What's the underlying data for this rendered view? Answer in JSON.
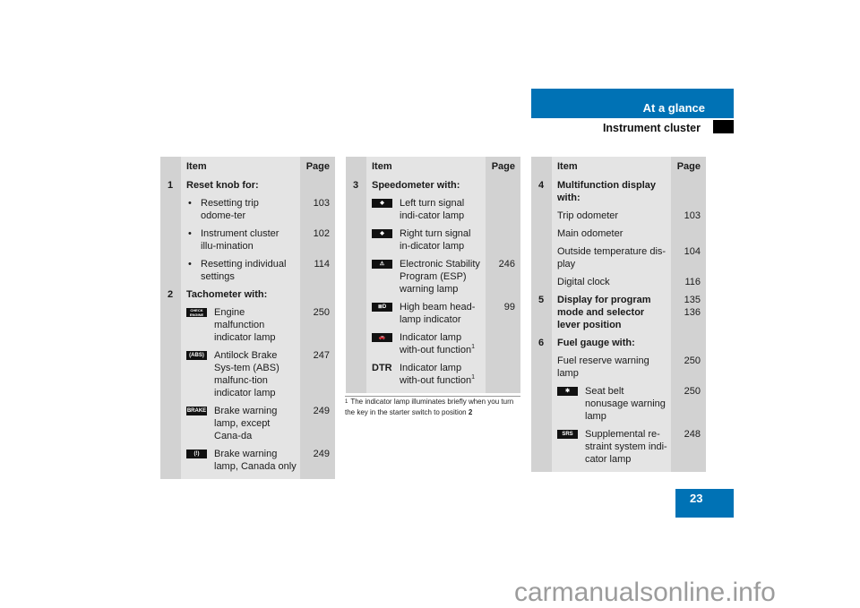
{
  "header": {
    "section": "At a glance",
    "subsection": "Instrument cluster",
    "accent_color": "#0072b5"
  },
  "page_number": "23",
  "watermark": "carmanualsonline.info",
  "tables": [
    {
      "col_item": "Item",
      "col_page": "Page",
      "rows": [
        {
          "type": "heading",
          "num": "1",
          "text": "Reset knob for:",
          "page": ""
        },
        {
          "type": "bullet",
          "text": "Resetting trip odome-ter",
          "page": "103"
        },
        {
          "type": "bullet",
          "text": "Instrument cluster illu-mination",
          "page": "102"
        },
        {
          "type": "bullet",
          "text": "Resetting individual settings",
          "page": "114"
        },
        {
          "type": "heading",
          "num": "2",
          "text": "Tachometer with:",
          "page": ""
        },
        {
          "type": "icon",
          "icon": "check-engine-icon",
          "icon_label": "CHECK ENGINE",
          "text": "Engine malfunction indicator lamp",
          "page": "250"
        },
        {
          "type": "icon",
          "icon": "abs-icon",
          "icon_label": "(ABS)",
          "text": "Antilock Brake Sys-tem (ABS) malfunc-tion indicator lamp",
          "page": "247"
        },
        {
          "type": "icon",
          "icon": "brake-icon",
          "icon_label": "BRAKE",
          "text": "Brake warning lamp, except Cana-da",
          "page": "249"
        },
        {
          "type": "icon",
          "icon": "brake-canada-icon",
          "icon_label": "(!)",
          "text": "Brake warning lamp, Canada only",
          "page": "249"
        }
      ]
    },
    {
      "col_item": "Item",
      "col_page": "Page",
      "rows": [
        {
          "type": "heading",
          "num": "3",
          "text": "Speedometer with:",
          "page": ""
        },
        {
          "type": "icon",
          "icon": "left-turn-signal-icon",
          "icon_label": "◆",
          "text": "Left turn signal indi-cator lamp",
          "page": ""
        },
        {
          "type": "icon",
          "icon": "right-turn-signal-icon",
          "icon_label": "◆",
          "text": "Right turn signal in-dicator lamp",
          "page": ""
        },
        {
          "type": "icon",
          "icon": "esp-warning-icon",
          "icon_label": "⚠",
          "text": "Electronic Stability Program (ESP) warning lamp",
          "page": "246"
        },
        {
          "type": "icon",
          "icon": "high-beam-icon",
          "icon_label": "≣D",
          "text": "High beam head-lamp indicator",
          "page": "99"
        },
        {
          "type": "icon",
          "icon": "distronic-car-icon",
          "icon_label": "🚗",
          "text": "Indicator lamp with-out function",
          "sup": "1",
          "page": ""
        },
        {
          "type": "dtr",
          "icon_label": "DTR",
          "text": "Indicator lamp with-out function",
          "sup": "1",
          "page": ""
        }
      ],
      "footnote": {
        "mark": "1",
        "text": "The indicator lamp illuminates briefly when you turn the key in the starter switch to position ",
        "bold_tail": "2"
      }
    },
    {
      "col_item": "Item",
      "col_page": "Page",
      "rows": [
        {
          "type": "heading",
          "num": "4",
          "text": "Multifunction display with:",
          "page": ""
        },
        {
          "type": "plain",
          "text": "Trip odometer",
          "page": "103"
        },
        {
          "type": "plain",
          "text": "Main odometer",
          "page": ""
        },
        {
          "type": "plain",
          "text": "Outside temperature dis-play",
          "page": "104"
        },
        {
          "type": "plain",
          "text": "Digital clock",
          "page": "116"
        },
        {
          "type": "heading",
          "num": "5",
          "text": "Display for program mode and selector lever position",
          "page": "135\n136"
        },
        {
          "type": "heading",
          "num": "6",
          "text": "Fuel gauge with:",
          "page": ""
        },
        {
          "type": "plain",
          "text": "Fuel reserve warning lamp",
          "page": "250"
        },
        {
          "type": "icon",
          "icon": "seat-belt-icon",
          "icon_label": "✱",
          "text": "Seat belt nonusage warning lamp",
          "page": "250"
        },
        {
          "type": "icon",
          "icon": "srs-icon",
          "icon_label": "SRS",
          "text": "Supplemental re-straint system indi-cator lamp",
          "page": "248"
        }
      ]
    }
  ]
}
